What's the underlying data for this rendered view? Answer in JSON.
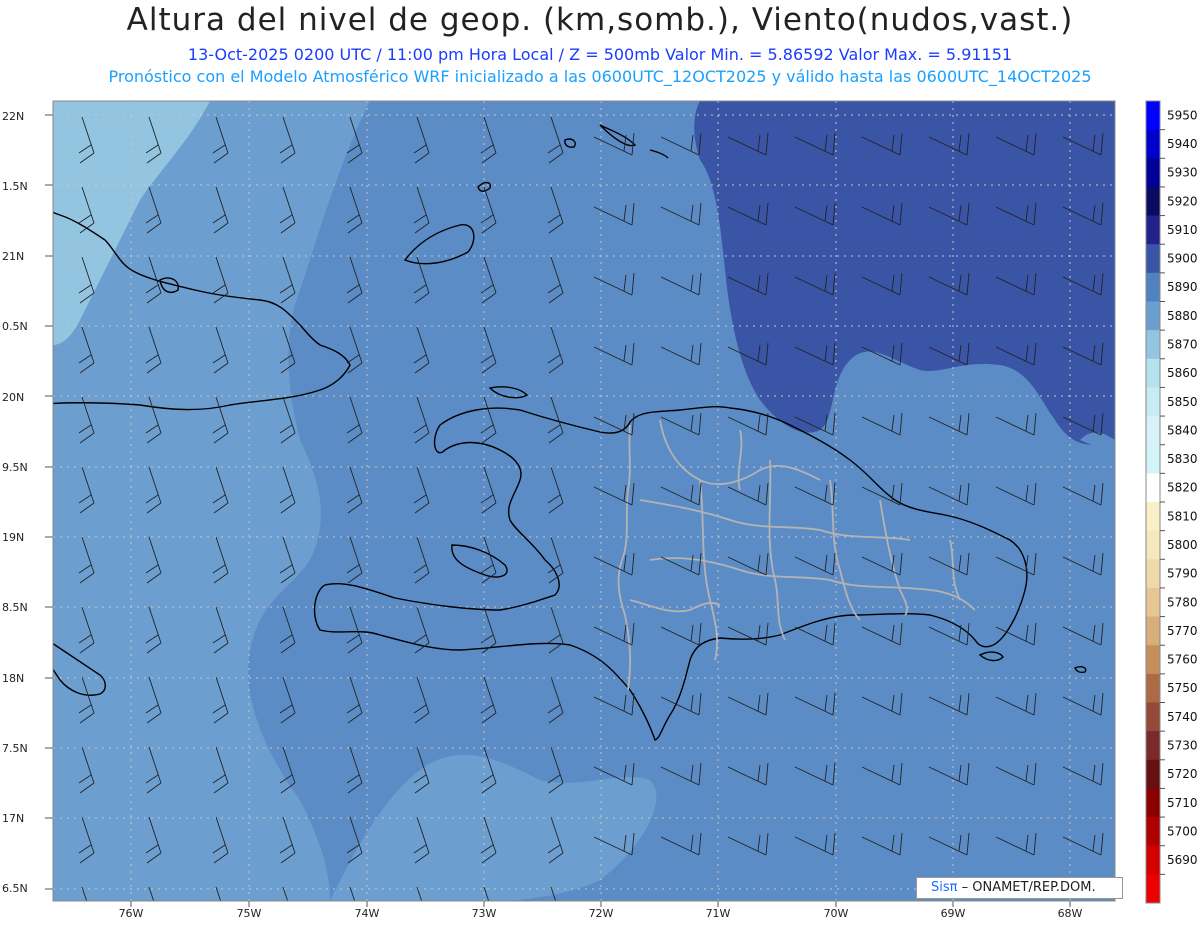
{
  "title": "Altura del nivel de geop. (km,somb.), Viento(nudos,vast.)",
  "subtitle_line1": "13-Oct-2025  0200 UTC / 11:00 pm Hora Local / Z = 500mb    Valor Min. = 5.86592  Valor Max. = 5.91151",
  "subtitle_line2": "Pronóstico con el Modelo Atmosférico WRF inicializado a las 0600UTC_12OCT2025 y válido hasta las  0600UTC_14OCT2025",
  "lat_labels": [
    "22N",
    "1.5N",
    "21N",
    "0.5N",
    "20N",
    "9.5N",
    "19N",
    "8.5N",
    "18N",
    "7.5N",
    "17N",
    "6.5N"
  ],
  "lon_labels": [
    "76W",
    "75W",
    "74W",
    "73W",
    "72W",
    "71W",
    "70W",
    "69W",
    "68W"
  ],
  "colorbar": {
    "levels": [
      5950,
      5940,
      5930,
      5920,
      5910,
      5900,
      5890,
      5880,
      5870,
      5860,
      5850,
      5840,
      5830,
      5820,
      5810,
      5800,
      5790,
      5780,
      5770,
      5760,
      5750,
      5740,
      5730,
      5720,
      5710,
      5700,
      5690
    ],
    "colors": [
      "#0000ff",
      "#0000cc",
      "#000099",
      "#0a0a60",
      "#22228a",
      "#3a55a5",
      "#4f82bf",
      "#6a9fcf",
      "#93c4e0",
      "#b5e2ee",
      "#c8ecf4",
      "#d8f2f8",
      "#d2f4f6",
      "#ffffff",
      "#f8f1c8",
      "#f5e8bd",
      "#eed9ab",
      "#e6c694",
      "#d8ae7a",
      "#c58f5c",
      "#ad6a44",
      "#944a38",
      "#7a2a2a",
      "#661010",
      "#8a0000",
      "#b00000",
      "#d40000",
      "#ee0000"
    ]
  },
  "credit": {
    "logo_prefix": "Sis",
    "logo_pi": "π",
    "text": "– ONAMET/REP.DOM."
  }
}
